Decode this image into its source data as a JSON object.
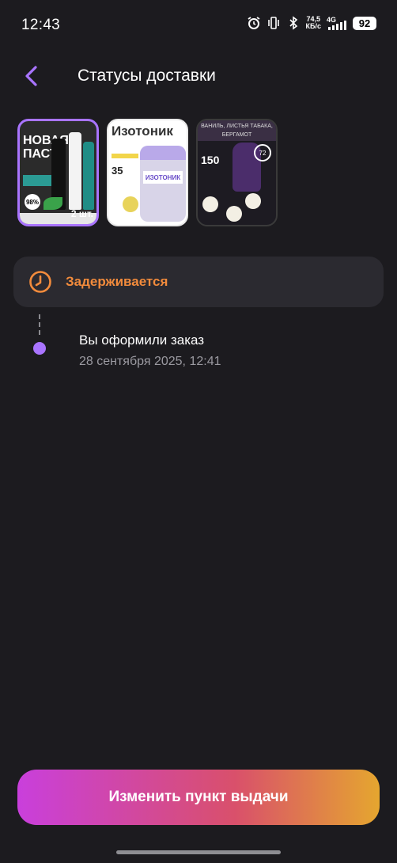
{
  "status_bar": {
    "time": "12:43",
    "net_speed_value": "74,5",
    "net_speed_unit": "КБ/с",
    "network": "4G",
    "battery": "92",
    "icons": [
      "alarm-icon",
      "vibrate-icon",
      "bluetooth-icon",
      "signal-icon"
    ]
  },
  "header": {
    "title": "Статусы доставки",
    "back_icon": "chevron-left-icon"
  },
  "thumbnails": [
    {
      "headline": "НОВАЯ ПАСТА",
      "badge": "98%",
      "count": "2 шт.",
      "selected": true
    },
    {
      "headline": "Изотоник",
      "number": "35",
      "label": "ИЗОТОНИК",
      "selected": false
    },
    {
      "headline": "ВАНИЛЬ, ЛИСТЬЯ ТАБАКА, БЕРГАМОТ",
      "number": "150",
      "badge": "72",
      "selected": false
    }
  ],
  "status": {
    "label": "Задерживается",
    "icon": "clock-icon",
    "color": "#f28b3c"
  },
  "timeline": [
    {
      "title": "Вы оформили заказ",
      "date": "28 сентября 2025, 12:41"
    }
  ],
  "actions": {
    "change_pickup": "Изменить пункт выдачи"
  },
  "colors": {
    "accent": "#a974ff",
    "background": "#1c1b1f",
    "card": "#2b2a30"
  }
}
